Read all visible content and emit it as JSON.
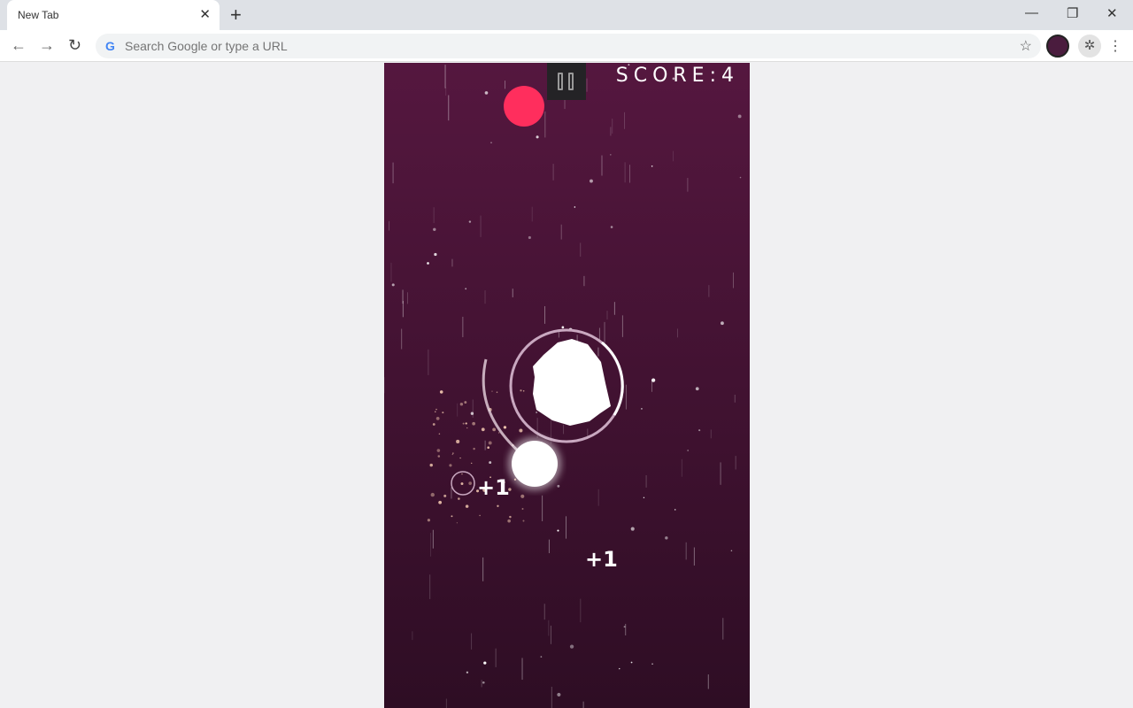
{
  "browser": {
    "tab_title": "New Tab",
    "omnibox_placeholder": "Search Google or type a URL"
  },
  "game": {
    "score_text": "SCORE:4",
    "score": 4,
    "popups": [
      "+1",
      "+1"
    ],
    "colors": {
      "background_top": "#55173f",
      "background_bottom": "#2e0d24",
      "enemy": "#ff2e5d",
      "player": "#ffffff"
    }
  }
}
